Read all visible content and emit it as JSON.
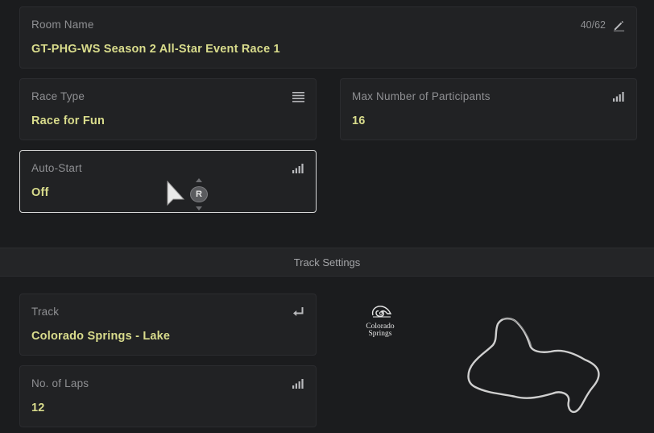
{
  "room_name": {
    "label": "Room Name",
    "value": "GT-PHG-WS Season 2 All-Star Event Race 1",
    "counter": "40/62",
    "icon": "pencil-icon"
  },
  "race_type": {
    "label": "Race Type",
    "value": "Race for Fun",
    "icon": "list-icon"
  },
  "max_participants": {
    "label": "Max Number of Participants",
    "value": "16",
    "icon": "signal-bars-icon"
  },
  "auto_start": {
    "label": "Auto-Start",
    "value": "Off",
    "icon": "signal-bars-icon",
    "focused": true
  },
  "controller_hint": {
    "button": "R"
  },
  "track_settings": {
    "title": "Track Settings",
    "track": {
      "label": "Track",
      "value": "Colorado Springs - Lake",
      "icon": "return-icon"
    },
    "laps": {
      "label": "No. of Laps",
      "value": "12",
      "icon": "signal-bars-icon"
    },
    "logo_text": [
      "Colorado",
      "Springs"
    ]
  },
  "colors": {
    "accent_value": "#d9dc8c",
    "label": "#8f9093",
    "background": "#1b1c1e",
    "panel": "#212224",
    "focus_border": "#d8d8d8"
  }
}
